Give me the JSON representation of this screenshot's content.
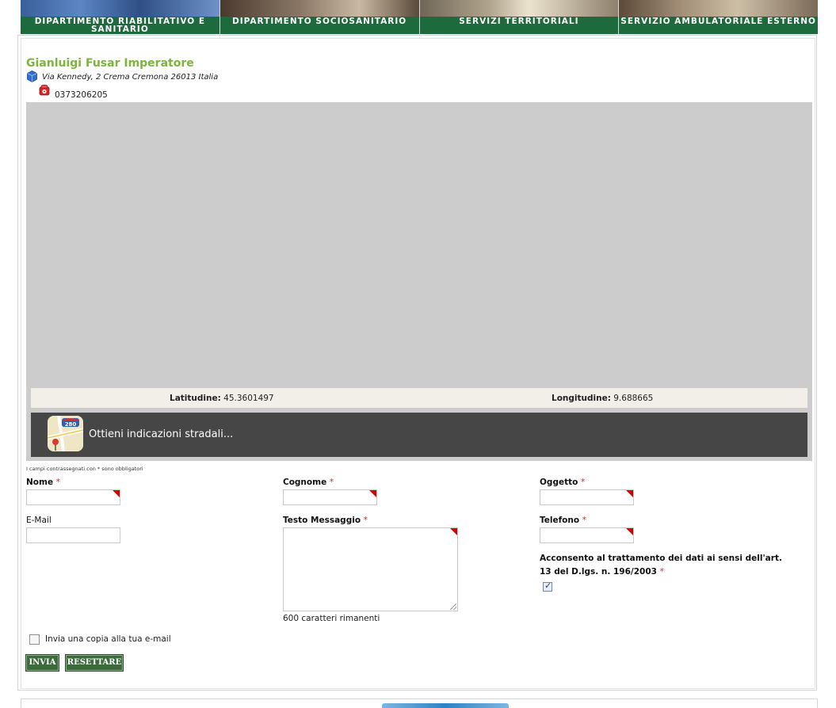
{
  "nav": {
    "items": [
      {
        "label": "DIPARTIMENTO RIABILITATIVO E SANITARIO"
      },
      {
        "label": "DIPARTIMENTO SOCIOSANITARIO"
      },
      {
        "label": "SERVIZI TERRITORIALI"
      },
      {
        "label": "SERVIZIO AMBULATORIALE ESTERNO"
      }
    ]
  },
  "contact": {
    "name": "Gianluigi Fusar Imperatore",
    "address": "Via Kennedy, 2 Crema Cremona 26013 Italia",
    "phone": "0373206205"
  },
  "map": {
    "latitude_label": "Latitudine:",
    "latitude": "45.3601497",
    "longitude_label": "Longitudine:",
    "longitude": "9.688665",
    "directions_label": "Ottieni indicazioni stradali...",
    "directions_icon_number": "280"
  },
  "form": {
    "required_note": "I campi contrassegnati con * sono obbligatori",
    "required_mark": "*",
    "fields": {
      "nome": {
        "label": "Nome",
        "value": ""
      },
      "cognome": {
        "label": "Cognome",
        "value": ""
      },
      "oggetto": {
        "label": "Oggetto",
        "value": ""
      },
      "email": {
        "label": "E-Mail",
        "value": ""
      },
      "messaggio": {
        "label": "Testo Messaggio",
        "value": ""
      },
      "telefono": {
        "label": "Telefono",
        "value": ""
      }
    },
    "chars_remaining": "600 caratteri rimanenti",
    "consent_text": "Acconsento al trattamento dei dati ai sensi dell'art. 13 del D.lgs. n. 196/2003",
    "consent_checked": true,
    "copy_label": "Invia una copia alla tua e-mail",
    "copy_checked": false,
    "submit_label": "INVIA",
    "reset_label": "RESETTARE"
  },
  "colors": {
    "nav_green": "#1d6a3c",
    "name_green": "#7bb53c",
    "button_green": "#3b6a3b",
    "required_red": "#d22"
  }
}
